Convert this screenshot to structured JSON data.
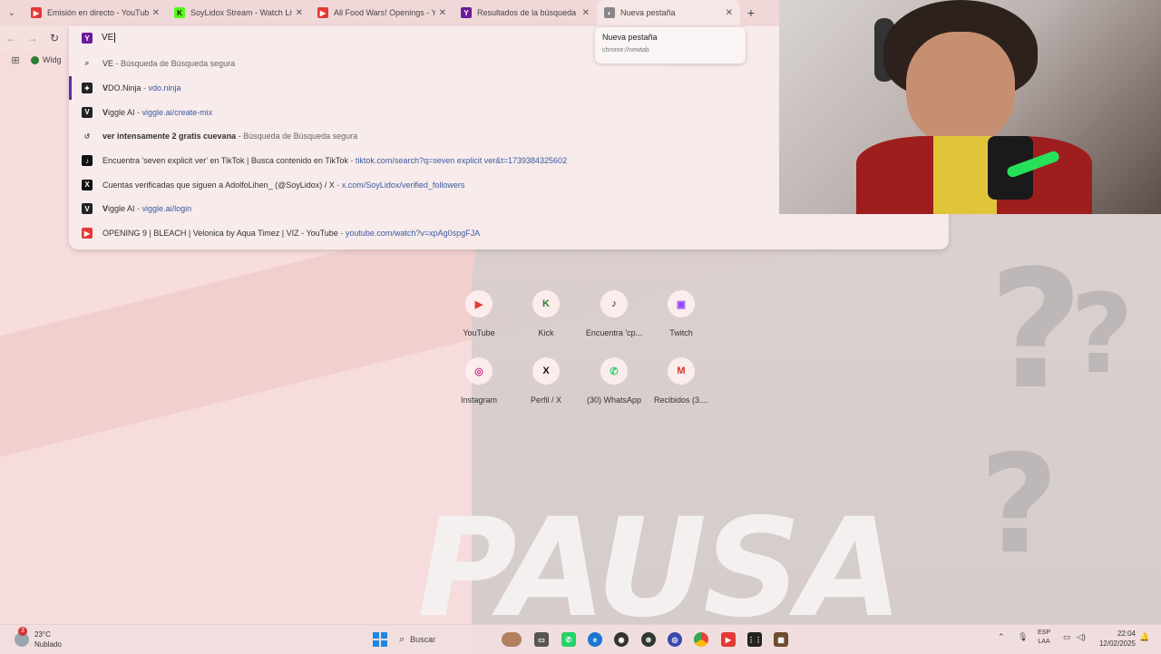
{
  "browser": {
    "tabs": [
      {
        "label": "Emisión en directo - YouTube S",
        "favicon_color": "#e53935",
        "favicon_glyph": "▶"
      },
      {
        "label": "SoyLidox Stream - Watch Live o",
        "favicon_color": "#53fc18",
        "favicon_glyph": "K"
      },
      {
        "label": "All Food Wars! Openings - You",
        "favicon_color": "#e53935",
        "favicon_glyph": "▶"
      },
      {
        "label": "Resultados de la búsqueda de",
        "favicon_color": "#6a1b9a",
        "favicon_glyph": "Y"
      },
      {
        "label": "Nueva pestaña",
        "favicon_color": "#888888",
        "favicon_glyph": "◐"
      }
    ],
    "omnibox": {
      "input_value": "VE",
      "suggestions": [
        {
          "icon": "search-icon",
          "bold": "",
          "main": "VE",
          "sep": " - ",
          "url": "",
          "tail": "Búsqueda de Búsqueda segura"
        },
        {
          "icon": "vdo-ninja-icon",
          "bold": "V",
          "main": "DO.Ninja",
          "sep": " - ",
          "url": "vdo.ninja",
          "tail": ""
        },
        {
          "icon": "viggle-icon",
          "bold": "V",
          "main": "iggle AI",
          "sep": " - ",
          "url": "viggle.ai/create-mix",
          "tail": ""
        },
        {
          "icon": "history-icon",
          "bold": "ver intensamente 2 gratis cuevana",
          "main": "",
          "sep": " - ",
          "url": "",
          "tail": "Búsqueda de Búsqueda segura"
        },
        {
          "icon": "tiktok-icon",
          "bold": "",
          "main": "Encuentra 'seven explicit ver' en TikTok | Busca contenido en TikTok",
          "sep": " - ",
          "url": "tiktok.com/search?q=seven explicit ver&t=1739384325602",
          "tail": ""
        },
        {
          "icon": "x-icon",
          "bold": "",
          "main": "Cuentas verificadas que siguen a AdolfoLihen_ (@SoyLidox) / X",
          "sep": " - ",
          "url": "x.com/SoyLidox/verified_followers",
          "tail": ""
        },
        {
          "icon": "viggle-icon",
          "bold": "V",
          "main": "iggle AI",
          "sep": " - ",
          "url": "viggle.ai/login",
          "tail": ""
        },
        {
          "icon": "youtube-icon",
          "bold": "",
          "main": "OPENING 9 | BLEACH | Velonica by Aqua Timez | VIZ - YouTube",
          "sep": " - ",
          "url": "youtube.com/watch?v=xpAg0spgFJA",
          "tail": ""
        }
      ]
    },
    "tooltip": {
      "title": "Nueva pestaña",
      "url": "chrome://newtab"
    },
    "bookmark_label": "Widg"
  },
  "shortcuts": [
    {
      "name": "YouTube",
      "icon": "youtube-icon",
      "glyph": "▶",
      "color": "#e53935"
    },
    {
      "name": "Kick",
      "icon": "kick-icon",
      "glyph": "K",
      "color": "#2e7d32"
    },
    {
      "name": "Encuentra 'cp...",
      "icon": "tiktok-icon",
      "glyph": "♪",
      "color": "#111111"
    },
    {
      "name": "Twitch",
      "icon": "twitch-icon",
      "glyph": "▣",
      "color": "#9146ff"
    },
    {
      "name": "Instagram",
      "icon": "instagram-icon",
      "glyph": "◎",
      "color": "#c13584"
    },
    {
      "name": "Perfil / X",
      "icon": "x-icon",
      "glyph": "X",
      "color": "#111111"
    },
    {
      "name": "(30) WhatsApp",
      "icon": "whatsapp-icon",
      "glyph": "✆",
      "color": "#25d366"
    },
    {
      "name": "Recibidos (3....",
      "icon": "gmail-icon",
      "glyph": "M",
      "color": "#d93025"
    }
  ],
  "overlay_text": "PAUSA",
  "taskbar": {
    "weather_temp": "23°C",
    "weather_desc": "Nublado",
    "weather_badge": "3",
    "search_label": "Buscar",
    "lang_top": "ESP",
    "lang_bottom": "LAA",
    "time": "22:04",
    "date": "12/02/2025"
  }
}
